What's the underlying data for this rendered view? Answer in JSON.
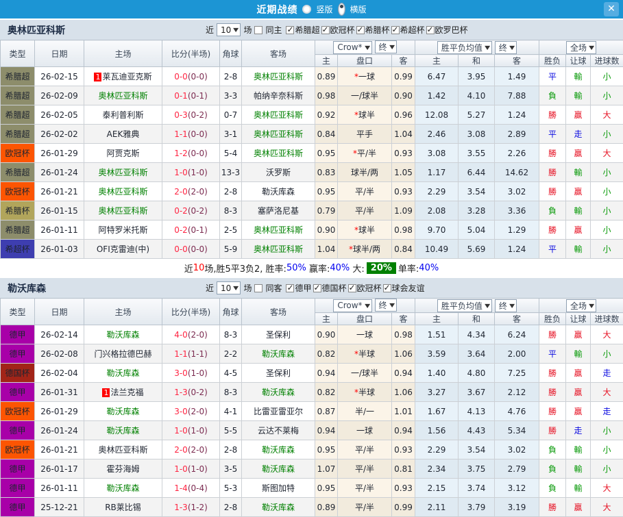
{
  "titlebar": {
    "title": "近期战绩",
    "vertical_label": "竖版",
    "horizontal_label": "横版",
    "selected_layout": "横版",
    "close_glyph": "✕",
    "bar_color": "#1c95d4"
  },
  "controls": {
    "recent_label": "近",
    "games_value": "10",
    "games_label": "场",
    "company_select": "Crow*",
    "final_select": "终",
    "avg_select": "胜平负均值",
    "final_select2": "终",
    "scope_select": "全场"
  },
  "columns": {
    "type": "类型",
    "date": "日期",
    "home": "主场",
    "score": "比分(半场)",
    "corner": "角球",
    "away": "客场",
    "odds_home": "主",
    "odds_line": "盘口",
    "odds_away": "客",
    "avg_home": "主",
    "avg_draw": "和",
    "avg_away": "客",
    "res_wdl": "胜负",
    "res_handicap": "让球",
    "res_goals": "进球数"
  },
  "league_colors": {
    "希腊超": "#8d8d6b",
    "欧冠杯": "#fc5502",
    "希腊杯": "#b1a55b",
    "希超杯": "#3e3eb0",
    "德甲": "#a800a8",
    "德国杯": "#a22418"
  },
  "sections": [
    {
      "team": "奥林匹亚科斯",
      "same_label": "同主",
      "same_checked": false,
      "leagues": [
        "希腊超",
        "欧冠杯",
        "希腊杯",
        "希超杯",
        "欧罗巴杯"
      ],
      "rows": [
        {
          "lg": "希腊超",
          "date": "26-02-15",
          "hb": "1",
          "home": "莱瓦迪亚克斯",
          "hg": false,
          "fs": "0-0",
          "hs": "(0-0)",
          "cn": "2-8",
          "away": "奥林匹亚科斯",
          "ag": true,
          "crow": [
            "0.89",
            "*一球",
            "0.99"
          ],
          "avg": [
            "6.47",
            "3.95",
            "1.49"
          ],
          "res": [
            [
              "平",
              "d"
            ],
            [
              "輸",
              "l"
            ],
            [
              "小",
              "l"
            ]
          ]
        },
        {
          "lg": "希腊超",
          "date": "26-02-09",
          "hb": "",
          "home": "奥林匹亚科斯",
          "hg": true,
          "fs": "0-1",
          "hs": "(0-1)",
          "cn": "3-3",
          "away": "帕纳辛奈科斯",
          "ag": false,
          "crow": [
            "0.98",
            "一/球半",
            "0.90"
          ],
          "avg": [
            "1.42",
            "4.10",
            "7.88"
          ],
          "res": [
            [
              "負",
              "l"
            ],
            [
              "輸",
              "l"
            ],
            [
              "小",
              "l"
            ]
          ]
        },
        {
          "lg": "希腊超",
          "date": "26-02-05",
          "hb": "",
          "home": "泰利普利斯",
          "hg": false,
          "fs": "0-3",
          "hs": "(0-2)",
          "cn": "0-7",
          "away": "奥林匹亚科斯",
          "ag": true,
          "crow": [
            "0.92",
            "*球半",
            "0.96"
          ],
          "avg": [
            "12.08",
            "5.27",
            "1.24"
          ],
          "res": [
            [
              "勝",
              "w"
            ],
            [
              "贏",
              "w"
            ],
            [
              "大",
              "w"
            ]
          ]
        },
        {
          "lg": "希腊超",
          "date": "26-02-02",
          "hb": "",
          "home": "AEK雅典",
          "hg": false,
          "fs": "1-1",
          "hs": "(0-0)",
          "cn": "3-1",
          "away": "奥林匹亚科斯",
          "ag": true,
          "crow": [
            "0.84",
            "平手",
            "1.04"
          ],
          "avg": [
            "2.46",
            "3.08",
            "2.89"
          ],
          "res": [
            [
              "平",
              "d"
            ],
            [
              "走",
              "d"
            ],
            [
              "小",
              "l"
            ]
          ]
        },
        {
          "lg": "欧冠杯",
          "date": "26-01-29",
          "hb": "",
          "home": "阿贾克斯",
          "hg": false,
          "fs": "1-2",
          "hs": "(0-0)",
          "cn": "5-4",
          "away": "奥林匹亚科斯",
          "ag": true,
          "crow": [
            "0.95",
            "*平/半",
            "0.93"
          ],
          "avg": [
            "3.08",
            "3.55",
            "2.26"
          ],
          "res": [
            [
              "勝",
              "w"
            ],
            [
              "贏",
              "w"
            ],
            [
              "大",
              "w"
            ]
          ]
        },
        {
          "lg": "希腊超",
          "date": "26-01-24",
          "hb": "",
          "home": "奥林匹亚科斯",
          "hg": true,
          "fs": "1-0",
          "hs": "(1-0)",
          "cn": "13-3",
          "away": "沃罗斯",
          "ag": false,
          "crow": [
            "0.83",
            "球半/两",
            "1.05"
          ],
          "avg": [
            "1.17",
            "6.44",
            "14.62"
          ],
          "res": [
            [
              "勝",
              "w"
            ],
            [
              "輸",
              "l"
            ],
            [
              "小",
              "l"
            ]
          ]
        },
        {
          "lg": "欧冠杯",
          "date": "26-01-21",
          "hb": "",
          "home": "奥林匹亚科斯",
          "hg": true,
          "fs": "2-0",
          "hs": "(2-0)",
          "cn": "2-8",
          "away": "勒沃库森",
          "ag": false,
          "crow": [
            "0.95",
            "平/半",
            "0.93"
          ],
          "avg": [
            "2.29",
            "3.54",
            "3.02"
          ],
          "res": [
            [
              "勝",
              "w"
            ],
            [
              "贏",
              "w"
            ],
            [
              "小",
              "l"
            ]
          ]
        },
        {
          "lg": "希腊杯",
          "date": "26-01-15",
          "hb": "",
          "home": "奥林匹亚科斯",
          "hg": true,
          "fs": "0-2",
          "hs": "(0-2)",
          "cn": "8-3",
          "away": "塞萨洛尼基",
          "ag": false,
          "crow": [
            "0.79",
            "平/半",
            "1.09"
          ],
          "avg": [
            "2.08",
            "3.28",
            "3.36"
          ],
          "res": [
            [
              "負",
              "l"
            ],
            [
              "輸",
              "l"
            ],
            [
              "小",
              "l"
            ]
          ]
        },
        {
          "lg": "希腊超",
          "date": "26-01-11",
          "hb": "",
          "home": "阿特罗米托斯",
          "hg": false,
          "fs": "0-2",
          "hs": "(0-1)",
          "cn": "2-5",
          "away": "奥林匹亚科斯",
          "ag": true,
          "crow": [
            "0.90",
            "*球半",
            "0.98"
          ],
          "avg": [
            "9.70",
            "5.04",
            "1.29"
          ],
          "res": [
            [
              "勝",
              "w"
            ],
            [
              "贏",
              "w"
            ],
            [
              "小",
              "l"
            ]
          ]
        },
        {
          "lg": "希超杯",
          "date": "26-01-03",
          "hb": "",
          "home": "OFI克雷迪(中)",
          "hg": false,
          "fs": "0-0",
          "hs": "(0-0)",
          "cn": "5-9",
          "away": "奥林匹亚科斯",
          "ag": true,
          "crow": [
            "1.04",
            "*球半/两",
            "0.84"
          ],
          "avg": [
            "10.49",
            "5.69",
            "1.24"
          ],
          "res": [
            [
              "平",
              "d"
            ],
            [
              "輸",
              "l"
            ],
            [
              "小",
              "l"
            ]
          ]
        }
      ],
      "summary": [
        [
          "近",
          "k"
        ],
        [
          "10",
          "r"
        ],
        [
          "场,胜5平3负2, 胜率:",
          "k"
        ],
        [
          "50%",
          "b"
        ],
        [
          " 赢率:",
          "k"
        ],
        [
          "40%",
          "b"
        ],
        [
          " 大:",
          "k"
        ],
        [
          "20%",
          "gb"
        ],
        [
          "单率:",
          "k"
        ],
        [
          "40%",
          "b"
        ]
      ]
    },
    {
      "team": "勒沃库森",
      "same_label": "同客",
      "same_checked": false,
      "leagues": [
        "德甲",
        "德国杯",
        "欧冠杯",
        "球会友谊"
      ],
      "rows": [
        {
          "lg": "德甲",
          "date": "26-02-14",
          "hb": "",
          "home": "勒沃库森",
          "hg": true,
          "fs": "4-0",
          "hs": "(2-0)",
          "cn": "8-3",
          "away": "圣保利",
          "ag": false,
          "crow": [
            "0.90",
            "一球",
            "0.98"
          ],
          "avg": [
            "1.51",
            "4.34",
            "6.24"
          ],
          "res": [
            [
              "勝",
              "w"
            ],
            [
              "贏",
              "w"
            ],
            [
              "大",
              "w"
            ]
          ]
        },
        {
          "lg": "德甲",
          "date": "26-02-08",
          "hb": "",
          "home": "门兴格拉德巴赫",
          "hg": false,
          "fs": "1-1",
          "hs": "(1-1)",
          "cn": "2-2",
          "away": "勒沃库森",
          "ag": true,
          "crow": [
            "0.82",
            "*半球",
            "1.06"
          ],
          "avg": [
            "3.59",
            "3.64",
            "2.00"
          ],
          "res": [
            [
              "平",
              "d"
            ],
            [
              "輸",
              "l"
            ],
            [
              "小",
              "l"
            ]
          ]
        },
        {
          "lg": "德国杯",
          "date": "26-02-04",
          "hb": "",
          "home": "勒沃库森",
          "hg": true,
          "fs": "3-0",
          "hs": "(1-0)",
          "cn": "4-5",
          "away": "圣保利",
          "ag": false,
          "crow": [
            "0.94",
            "一/球半",
            "0.94"
          ],
          "avg": [
            "1.40",
            "4.80",
            "7.25"
          ],
          "res": [
            [
              "勝",
              "w"
            ],
            [
              "贏",
              "w"
            ],
            [
              "走",
              "d"
            ]
          ]
        },
        {
          "lg": "德甲",
          "date": "26-01-31",
          "hb": "1",
          "home": "法兰克福",
          "hg": false,
          "fs": "1-3",
          "hs": "(0-2)",
          "cn": "8-3",
          "away": "勒沃库森",
          "ag": true,
          "crow": [
            "0.82",
            "*半球",
            "1.06"
          ],
          "avg": [
            "3.27",
            "3.67",
            "2.12"
          ],
          "res": [
            [
              "勝",
              "w"
            ],
            [
              "贏",
              "w"
            ],
            [
              "大",
              "w"
            ]
          ]
        },
        {
          "lg": "欧冠杯",
          "date": "26-01-29",
          "hb": "",
          "home": "勒沃库森",
          "hg": true,
          "fs": "3-0",
          "hs": "(2-0)",
          "cn": "4-1",
          "away": "比雷亚雷亚尔",
          "ag": false,
          "crow": [
            "0.87",
            "半/一",
            "1.01"
          ],
          "avg": [
            "1.67",
            "4.13",
            "4.76"
          ],
          "res": [
            [
              "勝",
              "w"
            ],
            [
              "贏",
              "w"
            ],
            [
              "走",
              "d"
            ]
          ]
        },
        {
          "lg": "德甲",
          "date": "26-01-24",
          "hb": "",
          "home": "勒沃库森",
          "hg": true,
          "fs": "1-0",
          "hs": "(1-0)",
          "cn": "5-5",
          "away": "云达不莱梅",
          "ag": false,
          "crow": [
            "0.94",
            "一球",
            "0.94"
          ],
          "avg": [
            "1.56",
            "4.43",
            "5.34"
          ],
          "res": [
            [
              "勝",
              "w"
            ],
            [
              "走",
              "d"
            ],
            [
              "小",
              "l"
            ]
          ]
        },
        {
          "lg": "欧冠杯",
          "date": "26-01-21",
          "hb": "",
          "home": "奥林匹亚科斯",
          "hg": false,
          "fs": "2-0",
          "hs": "(2-0)",
          "cn": "2-8",
          "away": "勒沃库森",
          "ag": true,
          "crow": [
            "0.95",
            "平/半",
            "0.93"
          ],
          "avg": [
            "2.29",
            "3.54",
            "3.02"
          ],
          "res": [
            [
              "負",
              "l"
            ],
            [
              "輸",
              "l"
            ],
            [
              "小",
              "l"
            ]
          ]
        },
        {
          "lg": "德甲",
          "date": "26-01-17",
          "hb": "",
          "home": "霍芬海姆",
          "hg": false,
          "fs": "1-0",
          "hs": "(1-0)",
          "cn": "3-5",
          "away": "勒沃库森",
          "ag": true,
          "crow": [
            "1.07",
            "平/半",
            "0.81"
          ],
          "avg": [
            "2.34",
            "3.75",
            "2.79"
          ],
          "res": [
            [
              "負",
              "l"
            ],
            [
              "輸",
              "l"
            ],
            [
              "小",
              "l"
            ]
          ]
        },
        {
          "lg": "德甲",
          "date": "26-01-11",
          "hb": "",
          "home": "勒沃库森",
          "hg": true,
          "fs": "1-4",
          "hs": "(0-4)",
          "cn": "5-3",
          "away": "斯图加特",
          "ag": false,
          "crow": [
            "0.95",
            "平/半",
            "0.93"
          ],
          "avg": [
            "2.15",
            "3.74",
            "3.12"
          ],
          "res": [
            [
              "負",
              "l"
            ],
            [
              "輸",
              "l"
            ],
            [
              "大",
              "w"
            ]
          ]
        },
        {
          "lg": "德甲",
          "date": "25-12-21",
          "hb": "",
          "home": "RB莱比锡",
          "hg": false,
          "fs": "1-3",
          "hs": "(1-2)",
          "cn": "2-8",
          "away": "勒沃库森",
          "ag": true,
          "crow": [
            "0.89",
            "平/半",
            "0.99"
          ],
          "avg": [
            "2.11",
            "3.79",
            "3.19"
          ],
          "res": [
            [
              "勝",
              "w"
            ],
            [
              "贏",
              "w"
            ],
            [
              "大",
              "w"
            ]
          ]
        }
      ],
      "summary": null
    }
  ]
}
